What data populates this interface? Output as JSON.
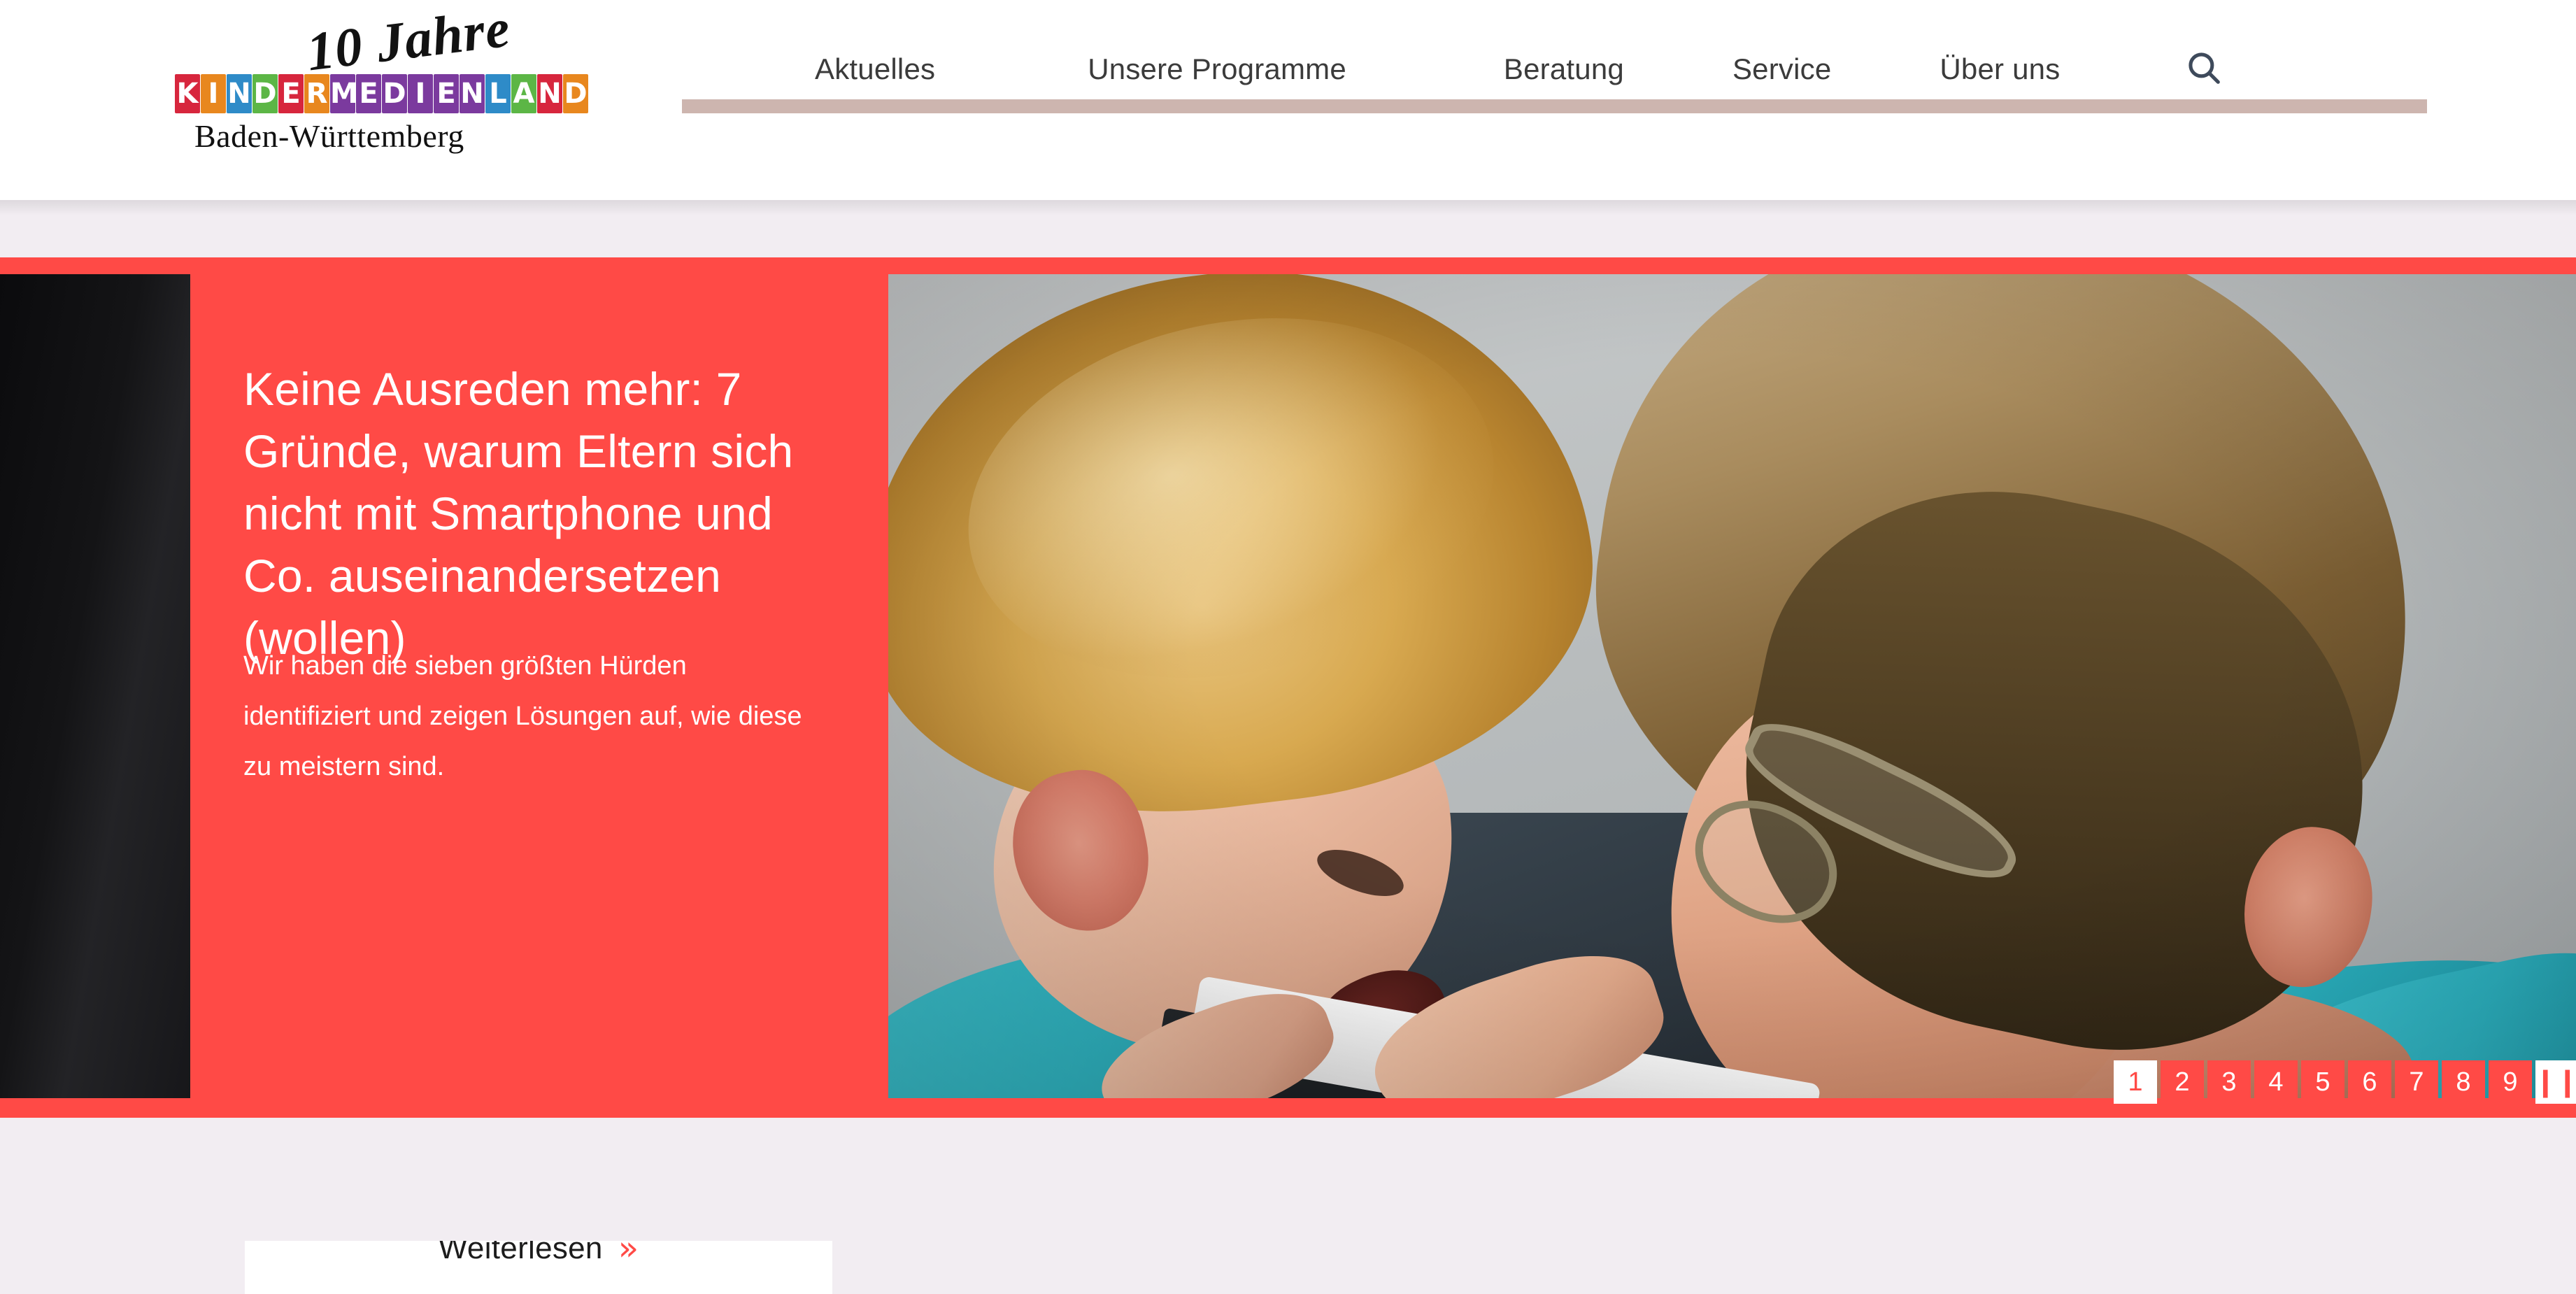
{
  "header": {
    "logo": {
      "tagline": "10 Jahre",
      "letters": [
        {
          "ch": "K",
          "color": "red"
        },
        {
          "ch": "I",
          "color": "orange"
        },
        {
          "ch": "N",
          "color": "blue"
        },
        {
          "ch": "D",
          "color": "green"
        },
        {
          "ch": "E",
          "color": "red"
        },
        {
          "ch": "R",
          "color": "orange"
        },
        {
          "ch": "M",
          "color": "purple"
        },
        {
          "ch": "E",
          "color": "purple"
        },
        {
          "ch": "D",
          "color": "purple"
        },
        {
          "ch": "I",
          "color": "purple"
        },
        {
          "ch": "E",
          "color": "purple"
        },
        {
          "ch": "N",
          "color": "purple"
        },
        {
          "ch": "L",
          "color": "blue"
        },
        {
          "ch": "A",
          "color": "green"
        },
        {
          "ch": "N",
          "color": "red"
        },
        {
          "ch": "D",
          "color": "orange"
        }
      ],
      "state": "Baden-Württemberg"
    },
    "nav": [
      {
        "label": "Aktuelles"
      },
      {
        "label": "Unsere Programme"
      },
      {
        "label": "Beratung"
      },
      {
        "label": "Service"
      },
      {
        "label": "Über uns"
      }
    ],
    "search_icon": "search-icon",
    "underline_color": "#CDB5AF"
  },
  "hero": {
    "title": "Keine Ausreden mehr: 7 Gründe, warum Eltern sich nicht mit Smartphone und Co. auseinandersetzen (wollen)",
    "description": "Wir haben die sieben größten Hürden identifiziert und zeigen Lösungen auf, wie diese zu meistern sind.",
    "button_label": "Weiterlesen",
    "button_chevron": "»",
    "accent_color": "#FF4A46",
    "image_alt": "Junge und Mann Stirn an Stirn mit Tablet"
  },
  "pagination": {
    "pages": [
      "1",
      "2",
      "3",
      "4",
      "5",
      "6",
      "7",
      "8",
      "9"
    ],
    "active": "1",
    "pause_label": "❙❙"
  }
}
